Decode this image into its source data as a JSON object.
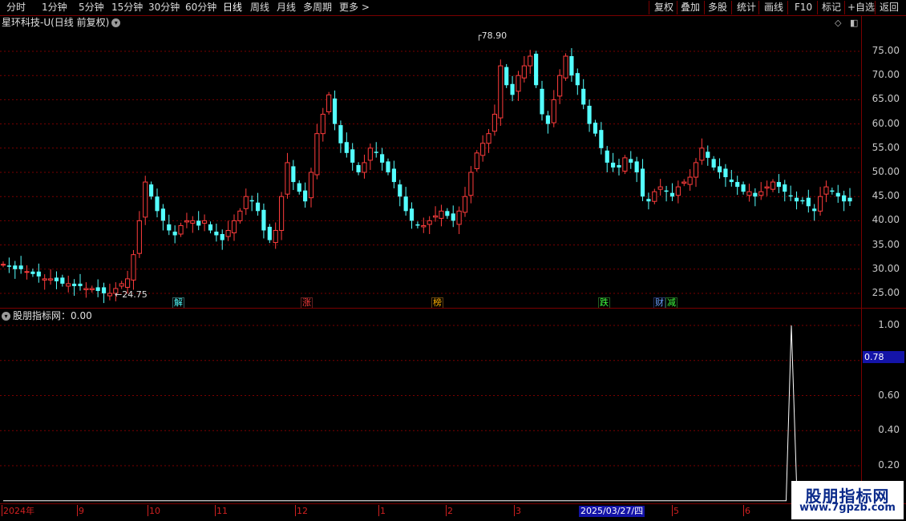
{
  "toolbar": {
    "left": [
      "分时",
      "1分钟",
      "5分钟",
      "15分钟",
      "30分钟",
      "60分钟",
      "日线",
      "周线",
      "月线",
      "多周期",
      "更多 >"
    ],
    "right": [
      "复权",
      "叠加",
      "多股",
      "统计",
      "画线",
      "F10",
      "标记",
      "+自选",
      "返回"
    ],
    "active": "日线"
  },
  "main": {
    "title": "星环科技-U(日线 前复权)",
    "price_axis": [
      "75.00",
      "70.00",
      "65.00",
      "60.00",
      "55.00",
      "50.00",
      "45.00",
      "40.00",
      "35.00",
      "30.00",
      "25.00"
    ],
    "high_label": "78.90",
    "low_label": "24.75",
    "tags": [
      "解",
      "涨",
      "榜",
      "跌",
      "财",
      "减"
    ],
    "colors": {
      "up": "#ff3c3c",
      "down": "#54ffff",
      "grid": "#7a0000"
    }
  },
  "indicator": {
    "title": "股朋指标网：0.00",
    "axis": [
      "1.00",
      "0.80",
      "0.60",
      "0.40",
      "0.20"
    ],
    "cursor_value": "0.78"
  },
  "time_axis": [
    "2024年",
    "9",
    "10",
    "11",
    "12",
    "1",
    "2",
    "3",
    "5",
    "6"
  ],
  "cursor_date": "2025/03/27/四",
  "watermark": {
    "line1": "股朋指标网",
    "line2": "www.7gpzb.com"
  },
  "chart_data": {
    "type": "candlestick",
    "title": "星环科技-U(日线 前复权)",
    "y_axis_range": [
      23,
      80
    ],
    "x_axis_labels": [
      "2024年",
      "9",
      "10",
      "11",
      "12",
      "1",
      "2",
      "3",
      "4",
      "5",
      "6"
    ],
    "series_close": [
      31,
      30.5,
      30,
      30,
      29.5,
      29,
      28.5,
      28,
      28,
      27.5,
      27,
      27,
      26.5,
      26.5,
      26,
      26,
      25.5,
      25,
      25,
      26,
      27,
      28,
      33,
      40,
      48,
      45,
      42,
      40,
      38,
      37,
      39,
      40,
      40,
      39,
      40,
      38,
      37,
      36,
      38,
      40,
      42,
      45,
      44,
      42,
      38,
      36,
      38,
      45,
      52,
      48,
      46,
      44,
      50,
      58,
      62,
      66,
      60,
      56,
      54,
      52,
      50,
      52,
      55,
      54,
      52,
      50,
      48,
      45,
      42,
      40,
      39,
      39,
      40,
      41,
      42,
      41,
      40,
      42,
      45,
      50,
      54,
      56,
      58,
      62,
      72,
      68,
      66,
      70,
      72,
      74,
      68,
      62,
      60,
      65,
      70,
      74,
      70,
      68,
      64,
      60,
      58,
      55,
      52,
      51,
      51,
      53,
      52,
      50,
      45,
      44,
      46,
      47,
      46,
      45,
      47,
      48,
      49,
      52,
      55,
      53,
      51,
      50,
      49,
      48,
      47,
      46,
      46,
      45,
      46,
      47,
      48,
      47,
      46,
      45,
      44,
      44,
      43,
      42,
      45,
      47,
      46,
      45,
      44,
      44
    ],
    "indicator_series": [
      0,
      0,
      0,
      0,
      0,
      0,
      0,
      0,
      0,
      0,
      0,
      0,
      0,
      0,
      0,
      0,
      0,
      0,
      0,
      0,
      0,
      0,
      0,
      0,
      0,
      0,
      0,
      0,
      0,
      0,
      0,
      0,
      0,
      0,
      0,
      0,
      0,
      0,
      0,
      0,
      0,
      0,
      0,
      0,
      0,
      0,
      0,
      0,
      0,
      0,
      0,
      0,
      0,
      0,
      0,
      0,
      0,
      0,
      0,
      0,
      0,
      0,
      0,
      0,
      0,
      0,
      0,
      0,
      0,
      0,
      0,
      0,
      0,
      0,
      0,
      0,
      0,
      0,
      0,
      0,
      0,
      0,
      0,
      0,
      0,
      0,
      0,
      0,
      0,
      0,
      0,
      0,
      0,
      0,
      0,
      0,
      0,
      0,
      0,
      0,
      0,
      0,
      0,
      0,
      0,
      0,
      0,
      0,
      0,
      0,
      0,
      0,
      0,
      0,
      0,
      0,
      0,
      0,
      0,
      0,
      0,
      0,
      0,
      0,
      0,
      0,
      0,
      0,
      0,
      0,
      0,
      0,
      0,
      0,
      0,
      0,
      0,
      0,
      0,
      0,
      0,
      0,
      0,
      0,
      0,
      0,
      0,
      0,
      0,
      0,
      0,
      1.0,
      0.1,
      0
    ]
  }
}
